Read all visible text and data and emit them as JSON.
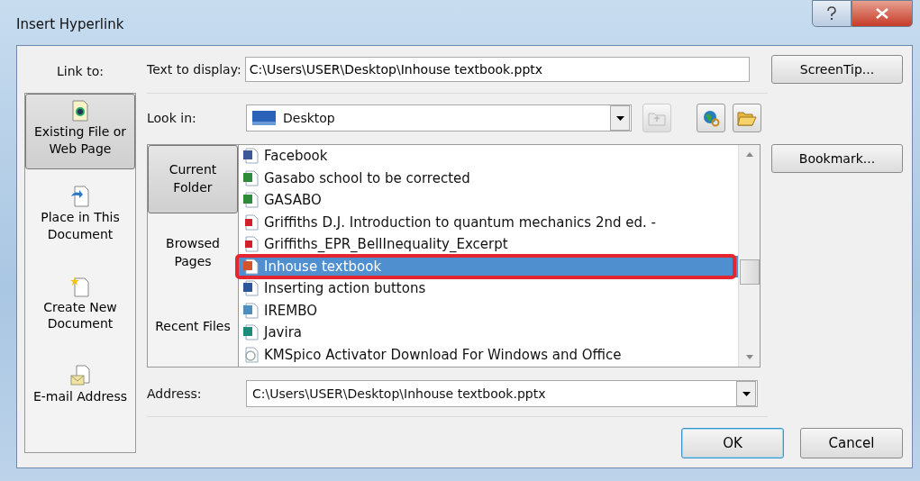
{
  "window": {
    "title": "Insert Hyperlink"
  },
  "link_to": {
    "label": "Link to:",
    "items": [
      {
        "label": "Existing File or Web Page",
        "kind": "file",
        "selected": true
      },
      {
        "label": "Place in This Document",
        "kind": "place",
        "selected": false
      },
      {
        "label": "Create New Document",
        "kind": "new",
        "selected": false
      },
      {
        "label": "E-mail Address",
        "kind": "email",
        "selected": false
      }
    ]
  },
  "text_to_display": {
    "label": "Text to display:",
    "value": "C:\\Users\\USER\\Desktop\\Inhouse textbook.pptx"
  },
  "screentip_button": "ScreenTip...",
  "look_in": {
    "label": "Look in:",
    "value": "Desktop"
  },
  "folder_buttons": [
    {
      "label": "Current Folder",
      "selected": true
    },
    {
      "label": "Browsed Pages",
      "selected": false
    },
    {
      "label": "Recent Files",
      "selected": false
    }
  ],
  "files": [
    {
      "name": "Facebook",
      "kind": "shortcut",
      "selected": false
    },
    {
      "name": "Gasabo school to be corrected",
      "kind": "excel",
      "selected": false
    },
    {
      "name": "GASABO",
      "kind": "excel",
      "selected": false
    },
    {
      "name": "Griffiths D.J. Introduction to quantum mechanics 2nd ed. -",
      "kind": "pdf",
      "selected": false
    },
    {
      "name": "Griffiths_EPR_BellInequality_Excerpt",
      "kind": "pdf",
      "selected": false
    },
    {
      "name": "Inhouse textbook",
      "kind": "powerpoint",
      "selected": true
    },
    {
      "name": "Inserting action buttons",
      "kind": "word",
      "selected": false
    },
    {
      "name": "IREMBO",
      "kind": "image",
      "selected": false
    },
    {
      "name": "Javira",
      "kind": "publisher",
      "selected": false
    },
    {
      "name": "KMSpico Activator Download For Windows and Office",
      "kind": "web",
      "selected": false
    }
  ],
  "bookmark_button": "Bookmark...",
  "address": {
    "label": "Address:",
    "value": "C:\\Users\\USER\\Desktop\\Inhouse textbook.pptx"
  },
  "buttons": [
    "OK",
    "Cancel"
  ]
}
